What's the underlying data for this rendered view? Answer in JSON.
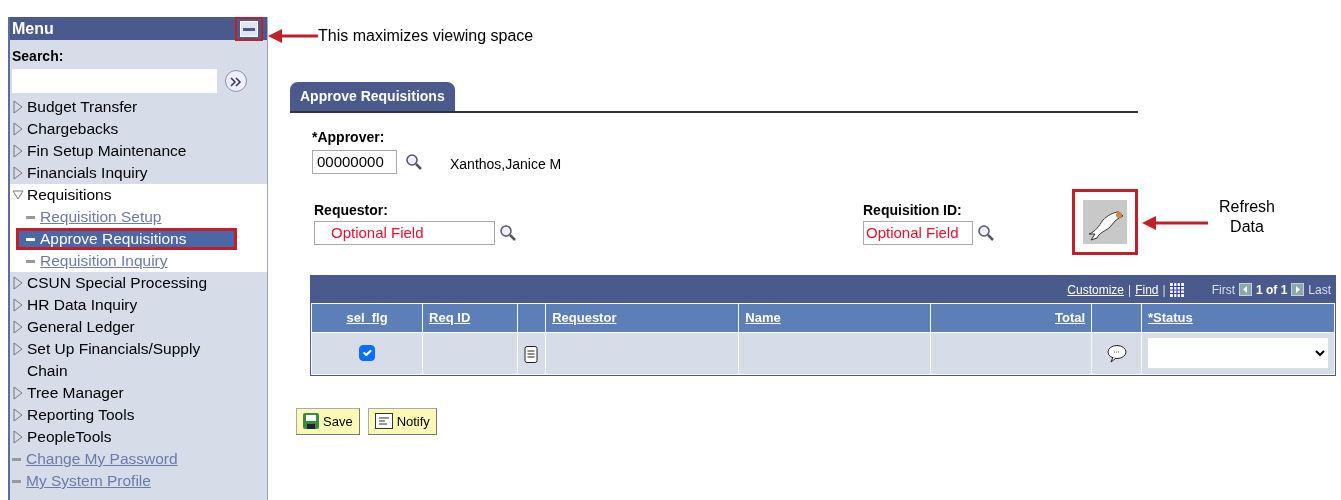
{
  "sidebar": {
    "title": "Menu",
    "collapse_highlighted": true,
    "search_label": "Search:",
    "items": [
      {
        "label": "Budget Transfer",
        "kind": "folder",
        "expanded": false,
        "selected": false
      },
      {
        "label": "Chargebacks",
        "kind": "folder",
        "expanded": false,
        "selected": false
      },
      {
        "label": "Fin Setup Maintenance",
        "kind": "folder",
        "expanded": false,
        "selected": false
      },
      {
        "label": "Financials Inquiry",
        "kind": "folder",
        "expanded": false,
        "selected": false
      },
      {
        "label": "Requisitions",
        "kind": "folder",
        "expanded": true,
        "selected": false,
        "children": [
          {
            "label": "Requisition Setup",
            "kind": "link",
            "selected": false
          },
          {
            "label": "Approve Requisitions",
            "kind": "link",
            "selected": true
          },
          {
            "label": "Requisition Inquiry",
            "kind": "link",
            "selected": false
          }
        ]
      },
      {
        "label": "CSUN Special Processing",
        "kind": "folder",
        "expanded": false,
        "selected": false
      },
      {
        "label": "HR Data Inquiry",
        "kind": "folder",
        "expanded": false,
        "selected": false
      },
      {
        "label": "General Ledger",
        "kind": "folder",
        "expanded": false,
        "selected": false
      },
      {
        "label": "Set Up Financials/Supply Chain",
        "kind": "folder",
        "expanded": false,
        "selected": false
      },
      {
        "label": "Tree Manager",
        "kind": "folder",
        "expanded": false,
        "selected": false
      },
      {
        "label": "Reporting Tools",
        "kind": "folder",
        "expanded": false,
        "selected": false
      },
      {
        "label": "PeopleTools",
        "kind": "folder",
        "expanded": false,
        "selected": false
      },
      {
        "label": "Change My Password",
        "kind": "link",
        "selected": false
      },
      {
        "label": "My System Profile",
        "kind": "link",
        "selected": false
      }
    ]
  },
  "callouts": [
    "This maximizes viewing space",
    "Refresh Data"
  ],
  "tabs": [
    {
      "label": "Approve Requisitions",
      "selected": true
    }
  ],
  "approver": {
    "label": "*Approver:",
    "value": "00000000",
    "name": "Xanthos,Janice M"
  },
  "requestor": {
    "label": "Requestor:",
    "placeholder": "Optional Field"
  },
  "requisition_id": {
    "label": "Requisition ID:",
    "placeholder": "Optional Field"
  },
  "refresh_button": {
    "highlighted": true
  },
  "grid": {
    "links": [
      "Customize",
      "Find"
    ],
    "separator": "|",
    "nav": {
      "first": "First",
      "range": "1 of 1",
      "last": "Last"
    },
    "columns": [
      {
        "label": "sel_flg",
        "kind": "checkbox"
      },
      {
        "label": "Req ID",
        "kind": "text"
      },
      {
        "kind": "notes"
      },
      {
        "label": "Requestor",
        "kind": "text"
      },
      {
        "label": "Name",
        "kind": "text"
      },
      {
        "label": "Total",
        "kind": "amount"
      },
      {
        "kind": "comment"
      },
      {
        "label": "*Status",
        "kind": "dropdown"
      }
    ],
    "rows": [
      {
        "checked": true
      }
    ]
  },
  "buttons": [
    {
      "label": "Save",
      "kind": "save"
    },
    {
      "label": "Notify",
      "kind": "notify"
    }
  ]
}
